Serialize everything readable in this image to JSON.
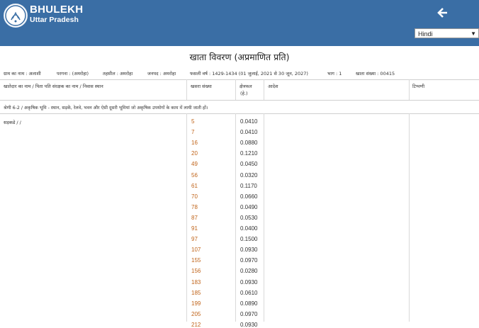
{
  "brand": {
    "title": "BHULEKH",
    "subtitle": "Uttar Pradesh"
  },
  "language_select": {
    "selected": "Hindi"
  },
  "page_title": "खाता विवरण (अप्रमाणित प्रति)",
  "meta": {
    "village": "ग्राम का नाम : अलाशी",
    "pargana": "परगना : (अमरोहा)",
    "tehsil": "तहसील : अमरोहा",
    "district": "जनपद : अमरोहा",
    "fasli": "फसली वर्ष : 1429-1434 (01 जुलाई, 2021 से 30 जून, 2027)",
    "bhag": "भाग : 1",
    "khata_no": "खाता संख्या : 00415"
  },
  "table": {
    "headers": {
      "owner": "खातेदार का नाम / पिता पति संरक्षक का नाम / निवास स्थान",
      "khasra": "खसरा संख्या",
      "area": "क्षेत्रफल",
      "area_unit": "(हे.)",
      "order": "आदेश",
      "remarks": "टिप्पणी"
    },
    "section_note": "श्रेणी 6-2 / अकृषिक भूमि - स्थान, सड़कें, रेलवे, भवन और ऐसी दूसरी भूमियां जो अकृषिक उपयोगों के काम में लायी जाती हों।",
    "owner_name": "सड़कडे / /",
    "rows": [
      {
        "khasra": "5",
        "area": "0.0410"
      },
      {
        "khasra": "7",
        "area": "0.0410"
      },
      {
        "khasra": "16",
        "area": "0.0880"
      },
      {
        "khasra": "20",
        "area": "0.1210"
      },
      {
        "khasra": "49",
        "area": "0.0450"
      },
      {
        "khasra": "56",
        "area": "0.0320"
      },
      {
        "khasra": "61",
        "area": "0.1170"
      },
      {
        "khasra": "70",
        "area": "0.0660"
      },
      {
        "khasra": "78",
        "area": "0.0490"
      },
      {
        "khasra": "87",
        "area": "0.0530"
      },
      {
        "khasra": "91",
        "area": "0.0400"
      },
      {
        "khasra": "97",
        "area": "0.1500"
      },
      {
        "khasra": "107",
        "area": "0.0930"
      },
      {
        "khasra": "155",
        "area": "0.0970"
      },
      {
        "khasra": "156",
        "area": "0.0280"
      },
      {
        "khasra": "183",
        "area": "0.0930"
      },
      {
        "khasra": "185",
        "area": "0.0610"
      },
      {
        "khasra": "199",
        "area": "0.0890"
      },
      {
        "khasra": "205",
        "area": "0.0970"
      },
      {
        "khasra": "212",
        "area": "0.0930"
      }
    ]
  },
  "colors": {
    "header_bg": "#3a6ea5",
    "khasra_text": "#c0641a"
  },
  "icons": {
    "logo": "up-emblem-icon",
    "back": "arrow-left-icon"
  }
}
